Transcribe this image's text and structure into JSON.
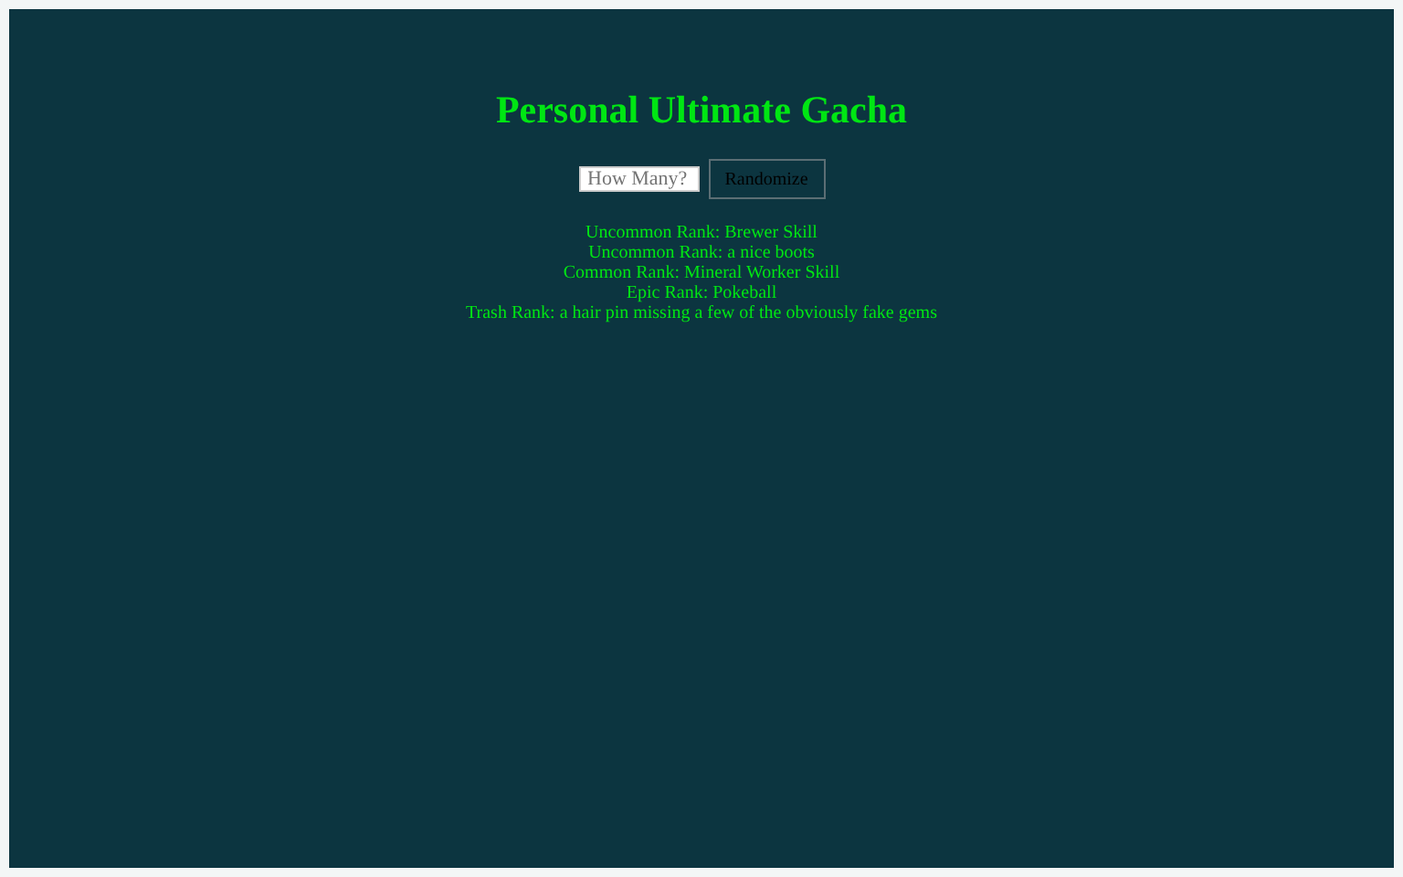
{
  "title": "Personal Ultimate Gacha",
  "form": {
    "placeholder": "How Many?",
    "button": "Randomize"
  },
  "results": [
    "Uncommon Rank: Brewer Skill",
    "Uncommon Rank: a nice boots",
    "Common Rank: Mineral Worker Skill",
    "Epic Rank: Pokeball",
    "Trash Rank: a hair pin missing a few of the obviously fake gems"
  ]
}
